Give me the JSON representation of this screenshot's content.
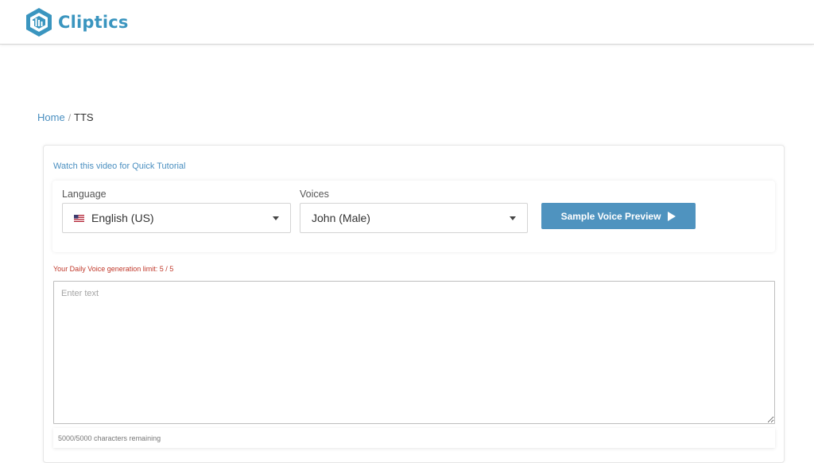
{
  "header": {
    "brand_name": "Cliptics",
    "logo_icon": "cliptics-hexagon-logo-icon",
    "brand_color": "#3a95bf"
  },
  "breadcrumb": {
    "home_label": "Home",
    "separator": "/",
    "current_label": "TTS"
  },
  "tts": {
    "tutorial_link": "Watch this video for Quick Tutorial",
    "language": {
      "label": "Language",
      "selected": "English (US)",
      "flag_icon": "us-flag-icon"
    },
    "voices": {
      "label": "Voices",
      "selected": "John (Male)"
    },
    "preview_button": {
      "label": "Sample Voice Preview",
      "icon": "play-icon",
      "color": "#4f93bf"
    },
    "limit_text": "Your Daily Voice generation limit: 5 / 5",
    "limit_color": "#c0392b",
    "text_input": {
      "placeholder": "Enter text",
      "value": ""
    },
    "characters_remaining": "5000/5000 characters remaining"
  }
}
